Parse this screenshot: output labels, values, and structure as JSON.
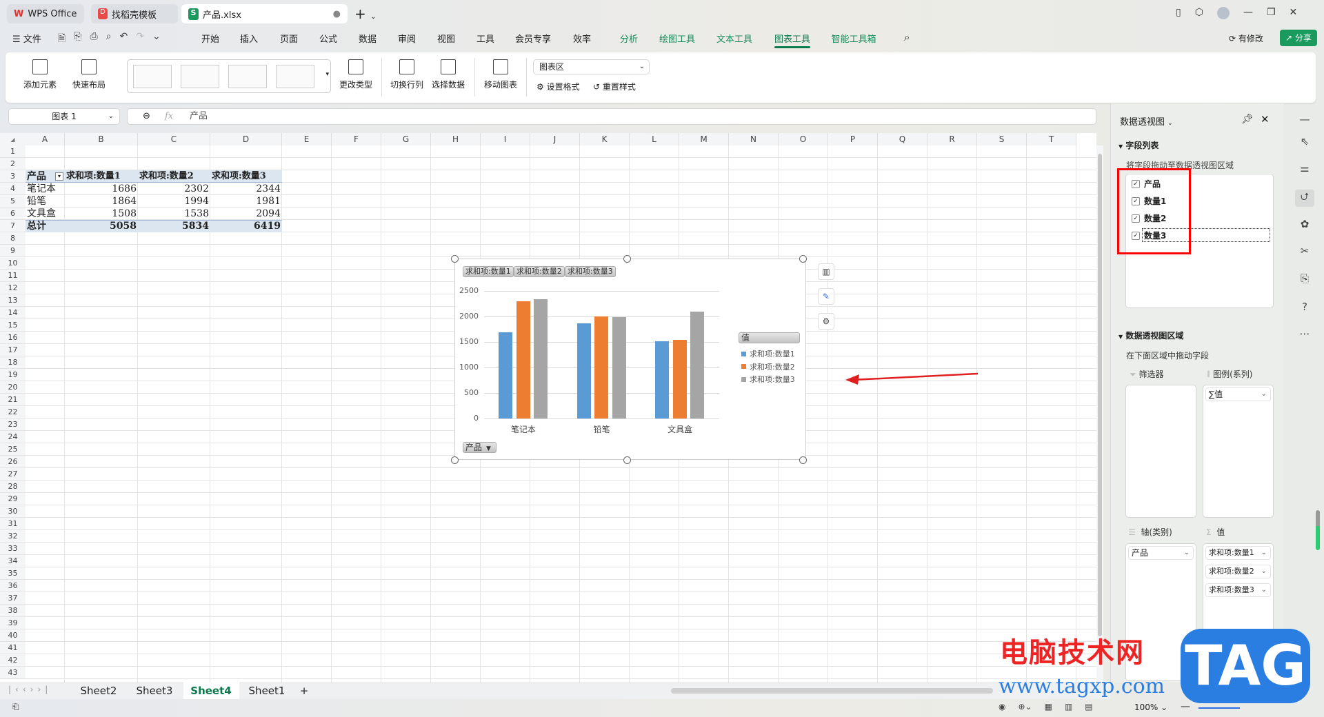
{
  "tabs": [
    {
      "label": "WPS Office",
      "icon": "wps-logo-icon"
    },
    {
      "label": "找稻壳模板",
      "icon": "docer-icon"
    },
    {
      "label": "产品.xlsx",
      "icon": "spreadsheet-icon"
    }
  ],
  "menu": {
    "file": "文件",
    "items": [
      "开始",
      "插入",
      "页面",
      "公式",
      "数据",
      "审阅",
      "视图",
      "工具",
      "会员专享",
      "效率",
      "分析",
      "绘图工具",
      "文本工具",
      "图表工具",
      "智能工具箱"
    ],
    "active": "图表工具",
    "modified": "有修改",
    "share": "分享"
  },
  "ribbon": {
    "add_element": "添加元素",
    "quick_layout": "快速布局",
    "change_type": "更改类型",
    "switch_row_col": "切换行列",
    "select_data": "选择数据",
    "move_chart": "移动图表",
    "chart_area": "图表区",
    "set_format": "设置格式",
    "reset_style": "重置样式"
  },
  "formula": {
    "name_box": "图表 1",
    "fx": "fx",
    "value": "产品"
  },
  "columns": [
    "A",
    "B",
    "C",
    "D",
    "E",
    "F",
    "G",
    "H",
    "I",
    "J",
    "K",
    "L",
    "M",
    "N",
    "O",
    "P",
    "Q",
    "R",
    "S",
    "T"
  ],
  "rows": [
    1,
    2,
    3,
    4,
    5,
    6,
    7,
    8,
    9,
    10,
    11,
    12,
    13,
    14,
    15,
    16,
    17,
    18,
    19,
    20,
    21,
    22,
    23,
    24,
    25,
    26,
    27,
    28,
    29,
    30,
    31,
    32,
    33,
    34,
    35,
    36,
    37,
    38,
    39,
    40,
    41,
    42,
    43
  ],
  "pivot_table": {
    "header": [
      "产品",
      "求和项:数量1",
      "求和项:数量2",
      "求和项:数量3"
    ],
    "rows": [
      [
        "笔记本",
        "1686",
        "2302",
        "2344"
      ],
      [
        "铅笔",
        "1864",
        "1994",
        "1981"
      ],
      [
        "文具盒",
        "1508",
        "1538",
        "2094"
      ]
    ],
    "total": [
      "总计",
      "5058",
      "5834",
      "6419"
    ]
  },
  "chart_data": {
    "type": "bar",
    "categories": [
      "笔记本",
      "铅笔",
      "文具盒"
    ],
    "series": [
      {
        "name": "求和项:数量1",
        "values": [
          1686,
          1864,
          1508
        ],
        "color": "#5b9bd5"
      },
      {
        "name": "求和项:数量2",
        "values": [
          2302,
          1994,
          1538
        ],
        "color": "#ed7d31"
      },
      {
        "name": "求和项:数量3",
        "values": [
          2344,
          1981,
          2094
        ],
        "color": "#a5a5a5"
      }
    ],
    "yticks": [
      "0",
      "500",
      "1000",
      "1500",
      "2000",
      "2500"
    ],
    "ylim": [
      0,
      2500
    ],
    "legend_title": "值",
    "legend_position": "right",
    "axis_field": "产品",
    "grid": true
  },
  "panel": {
    "title": "数据透视图",
    "field_list": "字段列表",
    "hint": "将字段拖动至数据透视图区域",
    "fields": [
      "产品",
      "数量1",
      "数量2",
      "数量3"
    ],
    "areas_title": "数据透视图区域",
    "areas_hint": "在下面区域中拖动字段",
    "filter": "筛选器",
    "legend": "图例(系列)",
    "legend_value": "∑值",
    "axis": "轴(类别)",
    "axis_value": "产品",
    "values": "值",
    "value_items": [
      "求和项:数量1",
      "求和项:数量2",
      "求和项:数量3"
    ]
  },
  "sheets": [
    "Sheet2",
    "Sheet3",
    "Sheet4",
    "Sheet1"
  ],
  "active_sheet": "Sheet4",
  "status": {
    "zoom": "100%"
  },
  "watermark": {
    "cn": "电脑技术网",
    "url": "www.tagxp.com",
    "tag": "TAG"
  },
  "accent": "#0d7a4e"
}
